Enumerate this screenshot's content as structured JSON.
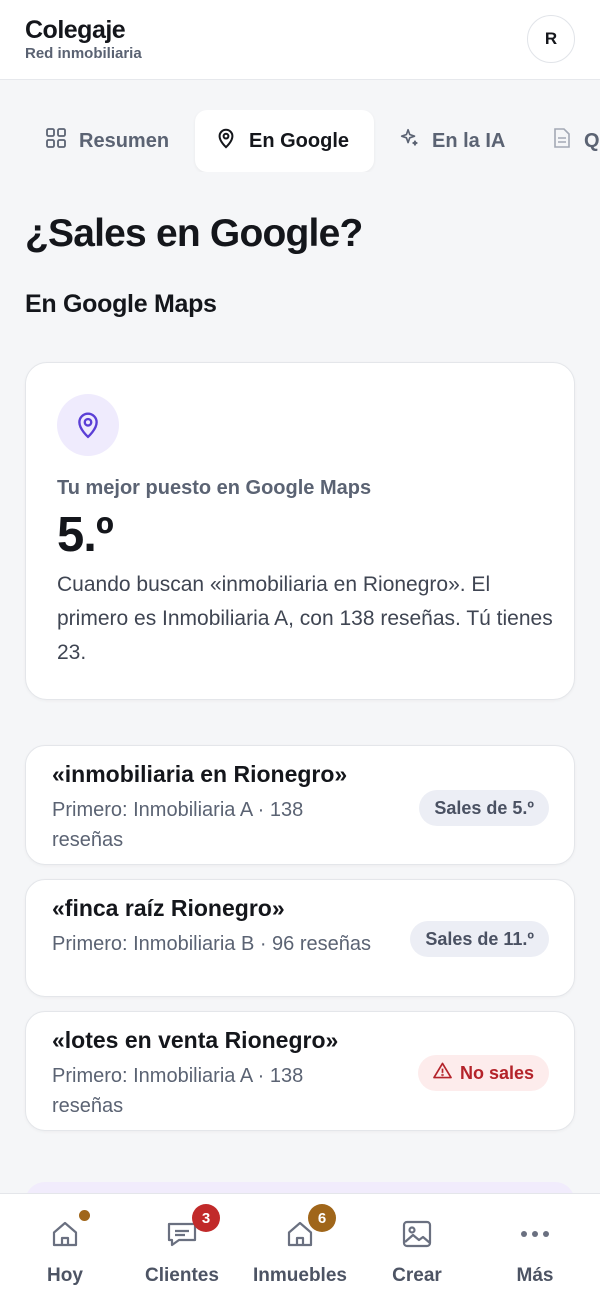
{
  "header": {
    "title": "Colegaje",
    "subtitle": "Red inmobiliaria",
    "avatar_initial": "R"
  },
  "tabs": [
    {
      "label": "Resumen",
      "icon": "grid-icon"
    },
    {
      "label": "En Google",
      "icon": "map-pin-icon",
      "active": true
    },
    {
      "label": "En la IA",
      "icon": "sparkle-icon"
    },
    {
      "label": "Q",
      "icon": "document-icon"
    }
  ],
  "page": {
    "title": "¿Sales en Google?",
    "section_title": "En Google Maps"
  },
  "summary": {
    "icon": "map-pin-icon",
    "label": "Tu mejor puesto en Google Maps",
    "rank": "5.º",
    "description": "Cuando buscan «inmobiliaria en Rionegro». El primero es Inmobiliaria A, con 138 reseñas. Tú tienes 23."
  },
  "keywords": [
    {
      "query": "«inmobiliaria en Rionegro»",
      "detail": "Primero: Inmobiliaria A · 138 reseñas",
      "status": "Sales de 5.º",
      "kind": "neutral"
    },
    {
      "query": "«finca raíz Rionegro»",
      "detail": "Primero: Inmobiliaria B · 96 reseñas",
      "status": "Sales de 11.º",
      "kind": "neutral"
    },
    {
      "query": "«lotes en venta Rionegro»",
      "detail": "Primero: Inmobiliaria A · 138 reseñas",
      "status": "No sales",
      "kind": "bad",
      "icon": "warning-icon"
    }
  ],
  "nav": [
    {
      "label": "Hoy",
      "icon": "home-icon",
      "dot": true
    },
    {
      "label": "Clientes",
      "icon": "chat-icon",
      "badge": "3"
    },
    {
      "label": "Inmuebles",
      "icon": "house-icon",
      "badge": "6"
    },
    {
      "label": "Crear",
      "icon": "image-icon"
    },
    {
      "label": "Más",
      "icon": "more-icon"
    }
  ],
  "colors": {
    "accent": "#5b3fd6",
    "accent_bg": "#efebfd",
    "danger": "#b4232a",
    "badge_red": "#c12a2a",
    "badge_amber": "#a0661a"
  }
}
